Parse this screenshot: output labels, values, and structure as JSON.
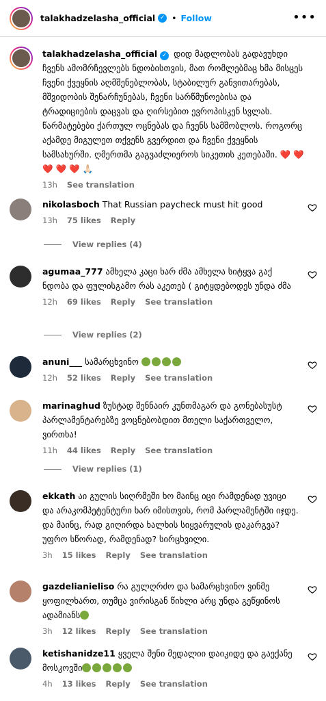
{
  "header": {
    "username": "talakhadzelasha_official",
    "separator": "•",
    "follow_label": "Follow",
    "more": "•••"
  },
  "caption": {
    "username": "talakhadzelasha_official",
    "text": "დიდ მადლობას გადავუხდი ჩვენს ამომრჩევლებს ნდობისთვის, მათ რომლებმაც ხმა მისცეს ჩვენი ქვეყნის აღმშენებლობას, სტაბილურ განვითარებას, მშვიდობის შენარჩუნებას, ჩვენი სარწმუნოებისა და ტრადიციების დაცვას და ღირსებით ევროპისკენ სვლას. წარმატებები ქართულ ოცნებას და ჩვენს სამშობლოს. როგორც აქამდე მიგულეთ თქვენს გვერდით და ჩვენი ქვეყნის სამსახურში. ღმერთმა გაგვაძლიეროს სიკეთის კეთებაში.",
    "hearts": "❤️ ❤️ ❤️ ❤️ ❤️ 🙏🏻",
    "time": "13h",
    "translate": "See translation"
  },
  "comments": [
    {
      "username": "nikolasboch",
      "text": "That Russian paycheck must hit good",
      "time": "13h",
      "likes": "75 likes",
      "reply": "Reply",
      "translate": "",
      "view_replies": "View replies (4)"
    },
    {
      "username": "agumaa_777",
      "text": "ამხელა კაცი ხარ ძმა ამხელა სიტყვა გაქ ნდობა და ფულისგამო რას აკეთებ ( გიტყდებოდეს უნდა ძმა",
      "time": "12h",
      "likes": "69 likes",
      "reply": "Reply",
      "translate": "See translation",
      "view_replies": "View replies (2)"
    },
    {
      "username": "anuni___",
      "text": "სამარცხვინო",
      "emoji_count": 4,
      "time": "12h",
      "likes": "52 likes",
      "reply": "Reply",
      "translate": "See translation",
      "view_replies": ""
    },
    {
      "username": "marinaghud",
      "text": "ზუსტად შენნაირ კუნთმაგარ და გონებასუსტ პარლამენტარებზე ვოცნებობდით მთელი საქართველო, ვირთხა!",
      "time": "11h",
      "likes": "44 likes",
      "reply": "Reply",
      "translate": "See translation",
      "view_replies": "View replies (1)"
    },
    {
      "username": "ekkath",
      "text": "აი გულის სიღრმეში ხო მაინც იცი რამდენად უვიცი და არაკომპეტენტური ხარ იმისთვის, რომ პარლამენტში იჯდე. და მაინც, რად გიღირდა ხალხის სიყვარულის დაკარგვა? უფრო სწორად, რამდენად? სირცხვილი.",
      "time": "3h",
      "likes": "15 likes",
      "reply": "Reply",
      "translate": "See translation",
      "view_replies": ""
    },
    {
      "username": "gazdelianieliso",
      "text": "რა გულღრძო და სამარცხვინო ვინმე ყოფილხართ, თუმცა ვირისგან წიხლი არც უნდა გეწყინოს ადამიანს",
      "emoji_count": 1,
      "time": "3h",
      "likes": "12 likes",
      "reply": "Reply",
      "translate": "See translation",
      "view_replies": ""
    },
    {
      "username": "ketishanidze11",
      "text": "ყველა შენი მედალიი დაიკიდე და გაექანე მოსკოვში",
      "emoji_count": 5,
      "time": "4h",
      "likes": "13 likes",
      "reply": "Reply",
      "translate": "See translation",
      "view_replies": ""
    }
  ],
  "colors": {
    "link": "#0095f6",
    "muted": "#737373",
    "heart": "#e0245e"
  }
}
